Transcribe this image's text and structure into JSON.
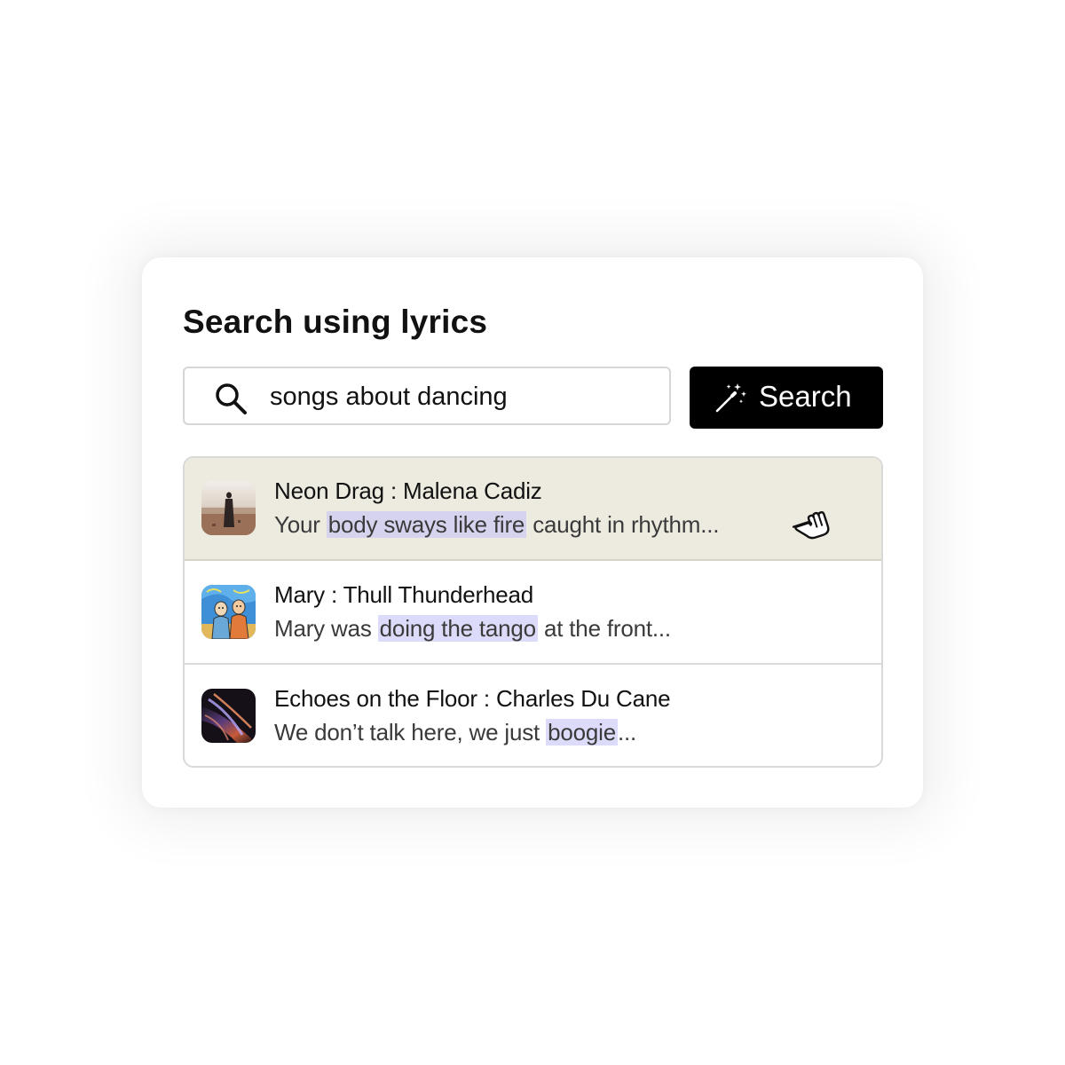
{
  "panel": {
    "title": "Search using lyrics"
  },
  "search": {
    "query": "songs about dancing",
    "icon": "search-icon",
    "button_label": "Search",
    "button_icon": "magic-wand-icon"
  },
  "results": [
    {
      "song": "Neon Drag",
      "separator": " : ",
      "artist": "Malena Cadiz",
      "lyric_before": "Your ",
      "lyric_highlight": "body sways like fire",
      "lyric_after": " caught in rhythm...",
      "hovered": true
    },
    {
      "song": "Mary",
      "separator": " : ",
      "artist": "Thull Thunderhead",
      "lyric_before": "Mary was ",
      "lyric_highlight": "doing the tango",
      "lyric_after": " at the front...",
      "hovered": false
    },
    {
      "song": "Echoes on the Floor",
      "separator": " : ",
      "artist": "Charles Du Cane",
      "lyric_before": "We don’t talk here, we just ",
      "lyric_highlight": "boogie",
      "lyric_after": "...",
      "hovered": false
    }
  ],
  "colors": {
    "hover_row": "#edeae0",
    "highlight": "#d6d3ee",
    "button": "#000000"
  },
  "pointer": "hand-pointer-icon"
}
